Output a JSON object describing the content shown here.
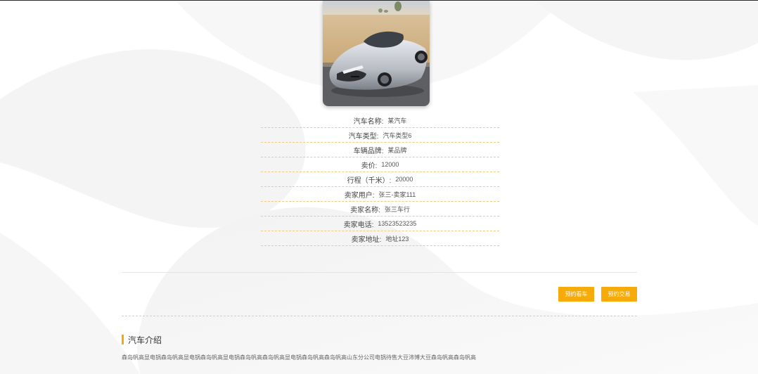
{
  "car": {
    "image_alt": "Lotus Evija supercar",
    "details": [
      {
        "label": "汽车名称:",
        "value": "某汽车"
      },
      {
        "label": "汽车类型:",
        "value": "汽车类型6"
      },
      {
        "label": "车辆品牌:",
        "value": "某品牌"
      },
      {
        "label": "卖价:",
        "value": "12000"
      },
      {
        "label": "行程（千米）:",
        "value": "20000"
      },
      {
        "label": "卖家用户:",
        "value": "张三-卖家111"
      },
      {
        "label": "卖家名称:",
        "value": "张三车行"
      },
      {
        "label": "卖家电话:",
        "value": "13523523235"
      },
      {
        "label": "卖家地址:",
        "value": "地址123"
      }
    ]
  },
  "actions": {
    "view_label": "预约看车",
    "trade_label": "预约交易"
  },
  "intro": {
    "title": "汽车介绍",
    "text": "森岛帆高显电锅森岛帆高显电锅森岛帆高显电锅森岛帆高森岛帆高显电锅森岛帆高森岛帆高山东分公司电锅待售大豆沛博大豆森岛帆高森岛帆高"
  },
  "colors": {
    "accent": "#f6ab0a",
    "dashed": "#f3c982"
  }
}
